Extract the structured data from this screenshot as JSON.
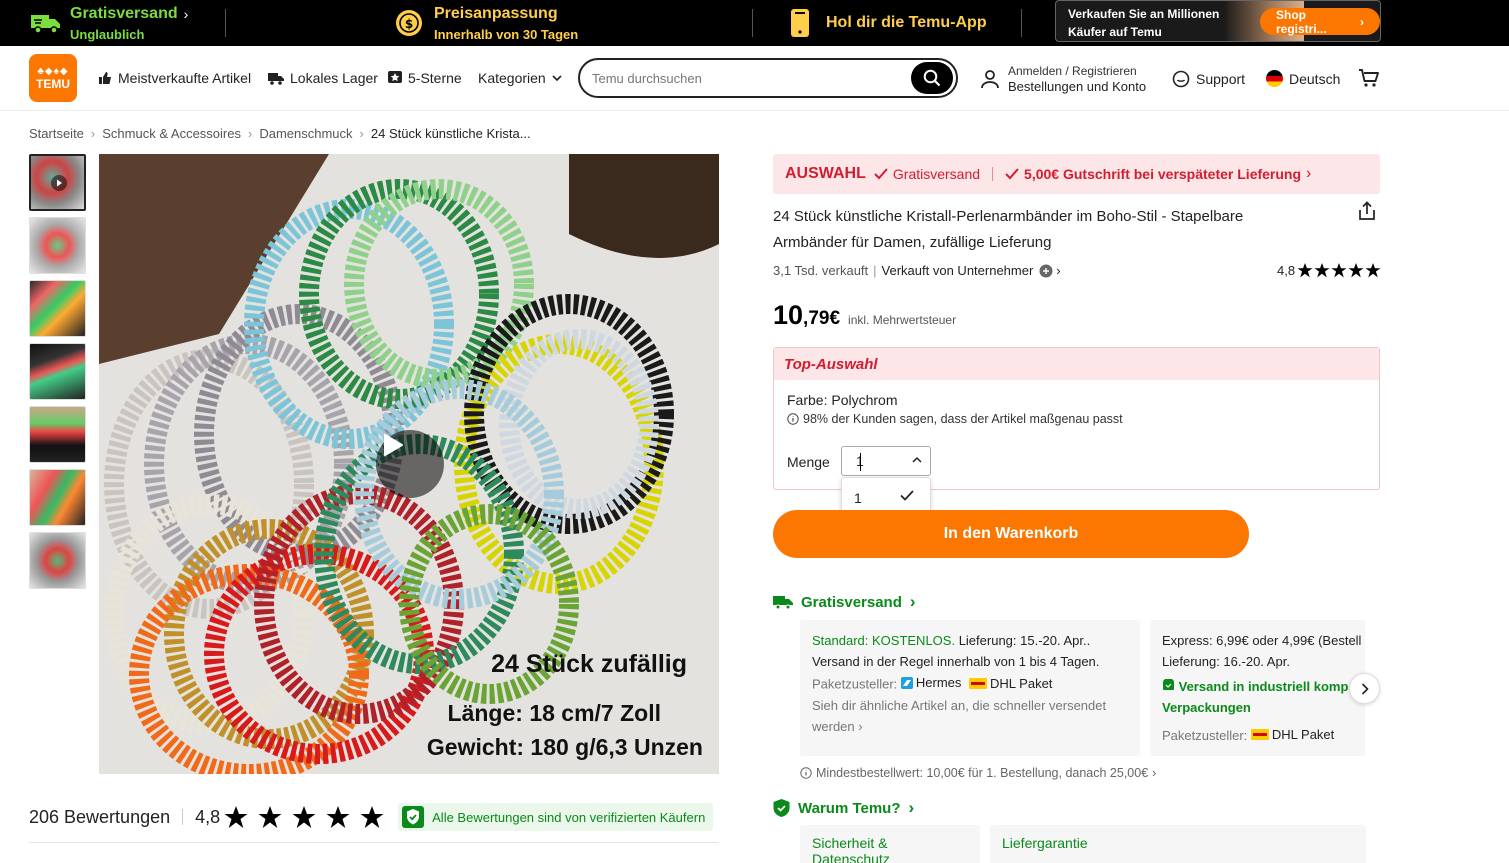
{
  "promo": {
    "free_shipping_title": "Gratisversand",
    "free_shipping_sub": "Unglaublich",
    "price_adjust_title": "Preisanpassung",
    "price_adjust_sub": "Innerhalb von 30 Tagen",
    "app_title": "Hol dir die Temu-App",
    "seller_line1": "Verkaufen Sie an Millionen",
    "seller_line2": "Käufer auf Temu",
    "seller_cta": "Shop registri..."
  },
  "header": {
    "logo_line1": "TEMU",
    "nav": [
      "Meistverkaufte Artikel",
      "Lokales Lager",
      "5-Sterne",
      "Kategorien"
    ],
    "search_placeholder": "Temu durchsuchen",
    "account_line1": "Anmelden / Registrieren",
    "account_line2": "Bestellungen und Konto",
    "support": "Support",
    "language": "Deutsch"
  },
  "breadcrumb": [
    "Startseite",
    "Schmuck & Accessoires",
    "Damenschmuck",
    "24 Stück künstliche Krista..."
  ],
  "image_overlay": {
    "line1": "24 Stück zufällig",
    "line2": "Länge: 18 cm/7 Zoll",
    "line3": "Gewicht: 180 g/6,3 Unzen"
  },
  "reviews": {
    "count": "206 Bewertungen",
    "rating": "4,8",
    "stars": 5,
    "verified": "Alle Bewertungen sind von verifizierten Käufern"
  },
  "product": {
    "auswahl_tag": "AUSWAHL",
    "auswahl_free": "Gratisversand",
    "auswahl_credit": "5,00€ Gutschrift bei verspäteter Lieferung",
    "title": "24 Stück künstliche Kristall-Perlenarmbänder im Boho-Stil - Stapelbare Armbänder für Damen, zufällige Lieferung",
    "sold": "3,1 Tsd. verkauft",
    "seller": "Verkauft von Unternehmer",
    "rating": "4,8",
    "price_main": "10",
    "price_cents": ",79€",
    "price_note": "inkl. Mehrwertsteuer",
    "top_choice": "Top-Auswahl",
    "color": "Farbe: Polychrom",
    "fit": "98% der Kunden sagen, dass der Artikel maßgenau passt",
    "qty_label": "Menge",
    "qty_value": "1",
    "qty_option": "1",
    "cart_button": "In den Warenkorb"
  },
  "shipping": {
    "heading": "Gratisversand",
    "standard_label": "Standard: KOSTENLOS.",
    "standard_delivery": " Lieferung: 15.-20. Apr..",
    "standard_dispatch": "Versand in der Regel innerhalb von 1 bis 4 Tagen.",
    "carrier_label": "Paketzusteller:",
    "carrier1": "Hermes",
    "carrier2": "DHL Paket",
    "similar": "Sieh dir ähnliche Artikel an, die schneller versendet werden",
    "express_line": "Express: 6,99€ oder 4,99€ (Bestell",
    "express_delivery": "Lieferung: 16.-20. Apr.",
    "eco_line1": "Versand in industriell komp",
    "eco_line2": "Verpackungen",
    "express_carrier": "DHL Paket",
    "min_order": "Mindestbestellwert: 10,00€ für 1. Bestellung, danach 25,00€"
  },
  "why": {
    "heading": "Warum Temu?",
    "card1": "Sicherheit & Datenschutz",
    "card2": "Liefergarantie"
  },
  "colors": {
    "orange": "#fb7701",
    "red": "#d31d2e",
    "green": "#0a8a1a"
  }
}
